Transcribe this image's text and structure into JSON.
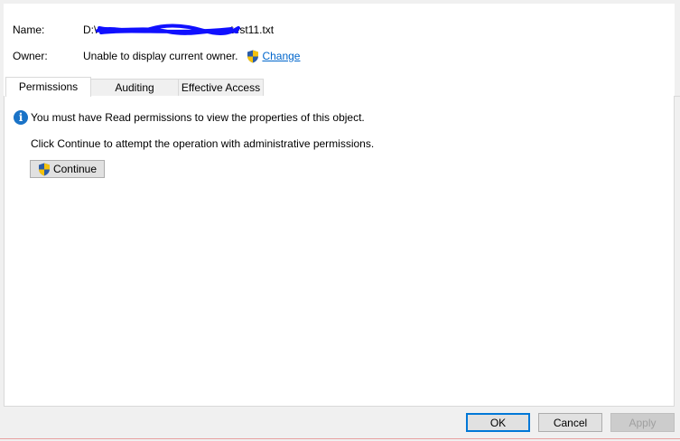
{
  "header": {
    "name_label": "Name:",
    "name_prefix": "D:\\",
    "name_suffix": "test11.txt",
    "owner_label": "Owner:",
    "owner_value": "Unable to display current owner.",
    "change_link": "Change"
  },
  "tabs": [
    {
      "label": "Permissions",
      "active": true
    },
    {
      "label": "Auditing",
      "active": false
    },
    {
      "label": "Effective Access",
      "active": false
    }
  ],
  "content": {
    "info_message": "You must have Read permissions to view the properties of this object.",
    "hint": "Click Continue to attempt the operation with administrative permissions.",
    "continue_label": "Continue"
  },
  "buttons": {
    "ok": "OK",
    "cancel": "Cancel",
    "apply": "Apply"
  },
  "colors": {
    "link": "#0066cc",
    "redaction": "#1010ff",
    "info_icon": "#1a73c7"
  }
}
